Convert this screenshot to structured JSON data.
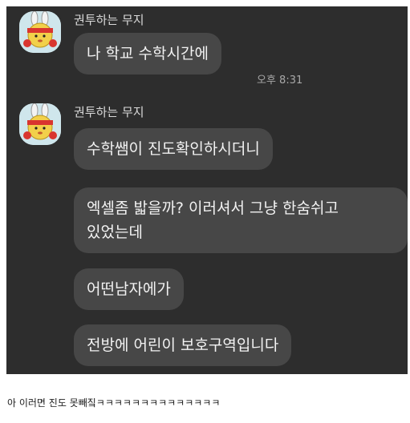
{
  "chat": {
    "groups": [
      {
        "sender": "권투하는 무지",
        "messages": [
          {
            "text": "나 학교 수학시간에"
          }
        ],
        "timestamp": "오후 8:31"
      },
      {
        "sender": "권투하는 무지",
        "messages": [
          {
            "text": "수학쌤이 진도확인하시더니"
          },
          {
            "line1": "엑셀좀 밟을까? 이러셔서 그냥 한숨쉬고",
            "line2": "있었는데"
          },
          {
            "text": "어떤남자에가"
          },
          {
            "text": "전방에 어린이 보호구역입니다"
          }
        ]
      }
    ],
    "avatar_icon": "muzi-boxer-avatar-icon",
    "colors": {
      "background": "#2d2d2d",
      "bubble": "#474747",
      "text": "#f2f2f2"
    }
  },
  "caption": "아 이러면 진도 못빼짘ㅋㅋㅋㅋㅋㅋㅋㅋㅋㅋㅋㅋㅋㅋ"
}
